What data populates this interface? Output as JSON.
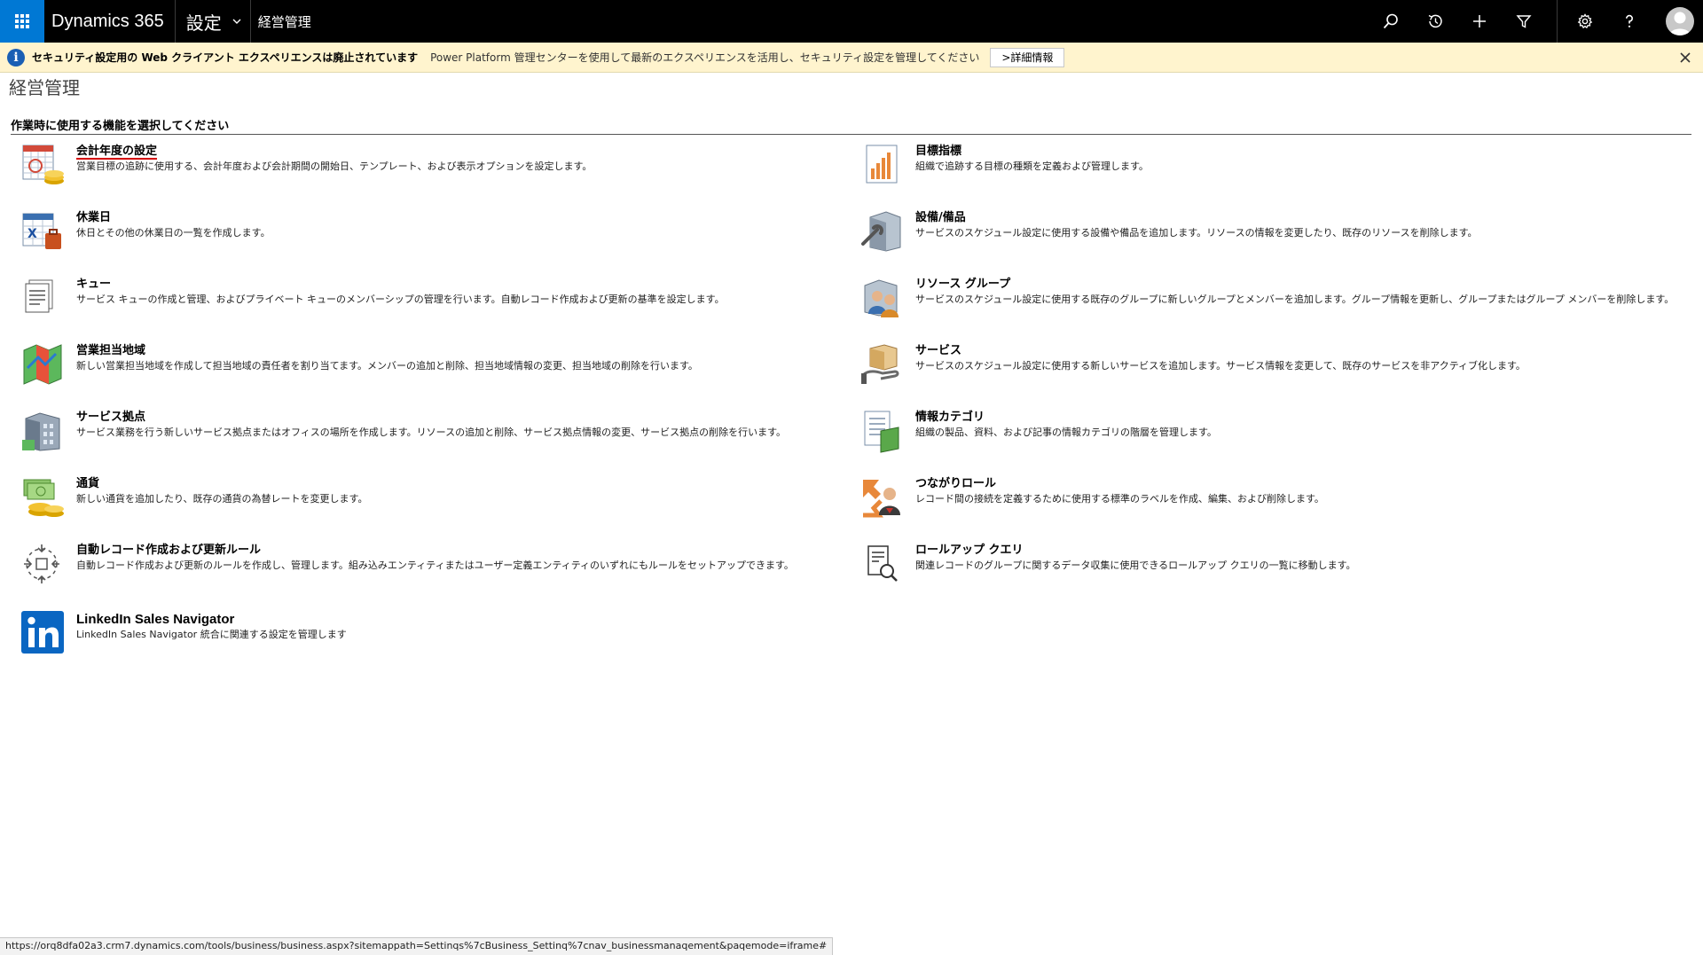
{
  "header": {
    "app_title": "Dynamics 365",
    "area_label": "設定",
    "breadcrumb": "経営管理"
  },
  "notice": {
    "bold_text": "セキュリティ設定用の Web クライアント エクスペリエンスは廃止されています",
    "text": "Power Platform 管理センターを使用して最新のエクスペリエンスを活用し、セキュリティ設定を管理してください",
    "button_label": ">詳細情報"
  },
  "page": {
    "title": "経営管理",
    "section_header": "作業時に使用する機能を選択してください"
  },
  "left_items": [
    {
      "title": "会計年度の設定",
      "desc": "営業目標の追跡に使用する、会計年度および会計期間の開始日、テンプレート、および表示オプションを設定します。",
      "icon": "fiscal-year-icon"
    },
    {
      "title": "休業日",
      "desc": "休日とその他の休業日の一覧を作成します。",
      "icon": "holiday-calendar-icon"
    },
    {
      "title": "キュー",
      "desc": "サービス キューの作成と管理、およびプライベート キューのメンバーシップの管理を行います。自動レコード作成および更新の基準を設定します。",
      "icon": "queue-icon"
    },
    {
      "title": "営業担当地域",
      "desc": "新しい営業担当地域を作成して担当地域の責任者を割り当てます。メンバーの追加と削除、担当地域情報の変更、担当地域の削除を行います。",
      "icon": "territory-map-icon"
    },
    {
      "title": "サービス拠点",
      "desc": "サービス業務を行う新しいサービス拠点またはオフィスの場所を作成します。リソースの追加と削除、サービス拠点情報の変更、サービス拠点の削除を行います。",
      "icon": "service-site-icon"
    },
    {
      "title": "通貨",
      "desc": "新しい通貨を追加したり、既存の通貨の為替レートを変更します。",
      "icon": "currency-icon"
    },
    {
      "title": "自動レコード作成および更新ルール",
      "desc": "自動レコード作成および更新のルールを作成し、管理します。組み込みエンティティまたはユーザー定義エンティティのいずれにもルールをセットアップできます。",
      "icon": "record-rules-icon"
    },
    {
      "title": "LinkedIn Sales Navigator",
      "desc": "LinkedIn Sales Navigator 統合に関連する設定を管理します",
      "icon": "linkedin-icon"
    }
  ],
  "right_items": [
    {
      "title": "目標指標",
      "desc": "組織で追跡する目標の種類を定義および管理します。",
      "icon": "goal-metrics-icon"
    },
    {
      "title": "設備/備品",
      "desc": "サービスのスケジュール設定に使用する設備や備品を追加します。リソースの情報を変更したり、既存のリソースを削除します。",
      "icon": "facilities-icon"
    },
    {
      "title": "リソース グループ",
      "desc": "サービスのスケジュール設定に使用する既存のグループに新しいグループとメンバーを追加します。グループ情報を更新し、グループまたはグループ メンバーを削除します。",
      "icon": "resource-group-icon"
    },
    {
      "title": "サービス",
      "desc": "サービスのスケジュール設定に使用する新しいサービスを追加します。サービス情報を変更して、既存のサービスを非アクティブ化します。",
      "icon": "service-icon"
    },
    {
      "title": "情報カテゴリ",
      "desc": "組織の製品、資料、および記事の情報カテゴリの階層を管理します。",
      "icon": "subject-icon"
    },
    {
      "title": "つながりロール",
      "desc": "レコード間の接続を定義するために使用する標準のラベルを作成、編集、および削除します。",
      "icon": "connection-role-icon"
    },
    {
      "title": "ロールアップ クエリ",
      "desc": "関連レコードのグループに関するデータ収集に使用できるロールアップ クエリの一覧に移動します。",
      "icon": "rollup-query-icon"
    }
  ],
  "status_url": "https://orq8dfa02a3.crm7.dynamics.com/tools/business/business.aspx?sitemappath=Settinqs%7cBusiness_Settinq%7cnav_businessmanaqement&paqemode=iframe#"
}
